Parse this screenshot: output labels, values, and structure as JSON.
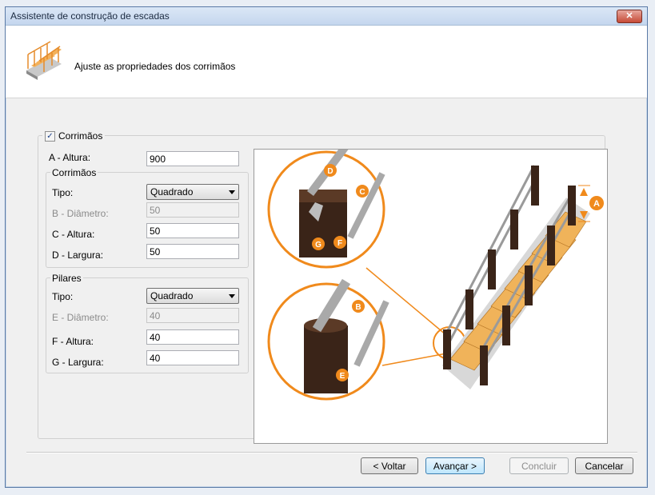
{
  "window": {
    "title": "Assistente de construção de escadas",
    "close_label": "✕"
  },
  "header": {
    "text": "Ajuste as propriedades dos corrimãos"
  },
  "main": {
    "checkbox_label": "Corrimãos",
    "checkbox_checked": true,
    "altura_label": "A - Altura:",
    "altura_value": "900",
    "corrimaos": {
      "title": "Corrimãos",
      "tipo_label": "Tipo:",
      "tipo_value": "Quadrado",
      "diametro_label": "B - Diâmetro:",
      "diametro_value": "50",
      "altura_label": "C - Altura:",
      "altura_value": "50",
      "largura_label": "D - Largura:",
      "largura_value": "50"
    },
    "pilares": {
      "title": "Pilares",
      "tipo_label": "Tipo:",
      "tipo_value": "Quadrado",
      "diametro_label": "E - Diâmetro:",
      "diametro_value": "40",
      "altura_label": "F - Altura:",
      "altura_value": "40",
      "largura_label": "G - Largura:",
      "largura_value": "40"
    }
  },
  "preview": {
    "markers": [
      "A",
      "B",
      "C",
      "D",
      "E",
      "F",
      "G"
    ]
  },
  "buttons": {
    "back": "< Voltar",
    "next": "Avançar >",
    "finish": "Concluir",
    "cancel": "Cancelar"
  },
  "colors": {
    "accent": "#f08a1c",
    "wood": "#3a2418",
    "step": "#f0b35a",
    "title_bg": "#c4d6ee"
  }
}
